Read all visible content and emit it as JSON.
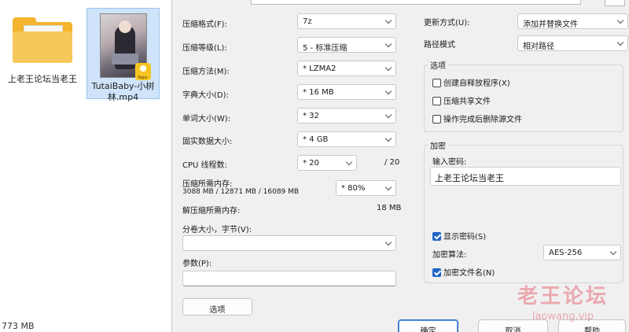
{
  "desktop": {
    "folder": {
      "name": "上老王论坛当老王"
    },
    "video": {
      "name": "TutaiBaby-小树林.mp4",
      "badge": "Pape"
    },
    "status": {
      "size": "773 MB"
    }
  },
  "dialog": {
    "left": {
      "format": {
        "label": "压缩格式(F):",
        "value": "7z"
      },
      "level": {
        "label": "压缩等级(L):",
        "value": "5 - 标准压缩"
      },
      "method": {
        "label": "压缩方法(M):",
        "value": "* LZMA2"
      },
      "dict": {
        "label": "字典大小(D):",
        "value": "* 16 MB"
      },
      "word": {
        "label": "单词大小(W):",
        "value": "* 32"
      },
      "solid": {
        "label": "固实数据大小:",
        "value": "* 4 GB"
      },
      "cpu": {
        "label": "CPU 线程数:",
        "value": "* 20",
        "total": "/ 20"
      },
      "mem": {
        "label": "压缩所需内存:",
        "detail": "3088 MB / 12871 MB / 16089 MB",
        "value": "* 80%"
      },
      "decomp": {
        "label": "解压缩所需内存:",
        "value": "18 MB"
      },
      "split": {
        "label": "分卷大小，字节(V):",
        "value": ""
      },
      "params": {
        "label": "参数(P):",
        "value": ""
      },
      "options_button": "选项"
    },
    "right": {
      "update": {
        "label": "更新方式(U):",
        "value": "添加并替换文件"
      },
      "path": {
        "label": "路径模式",
        "value": "相对路径"
      },
      "options": {
        "title": "选项",
        "items": [
          {
            "label": "创建自释放程序(X)",
            "checked": false
          },
          {
            "label": "压缩共享文件",
            "checked": false
          },
          {
            "label": "操作完成后删除源文件",
            "checked": false
          }
        ]
      },
      "encryption": {
        "title": "加密",
        "password_label": "输入密码:",
        "password_value": "上老王论坛当老王",
        "show_password": {
          "label": "显示密码(S)",
          "checked": true
        },
        "method_label": "加密算法:",
        "method_value": "AES-256",
        "encrypt_names": {
          "label": "加密文件名(N)",
          "checked": true
        }
      }
    },
    "buttons": {
      "ok": "确定",
      "cancel": "取消",
      "help": "帮助"
    }
  },
  "watermark": {
    "line1": "老王论坛",
    "line2": "laowang.vip"
  }
}
